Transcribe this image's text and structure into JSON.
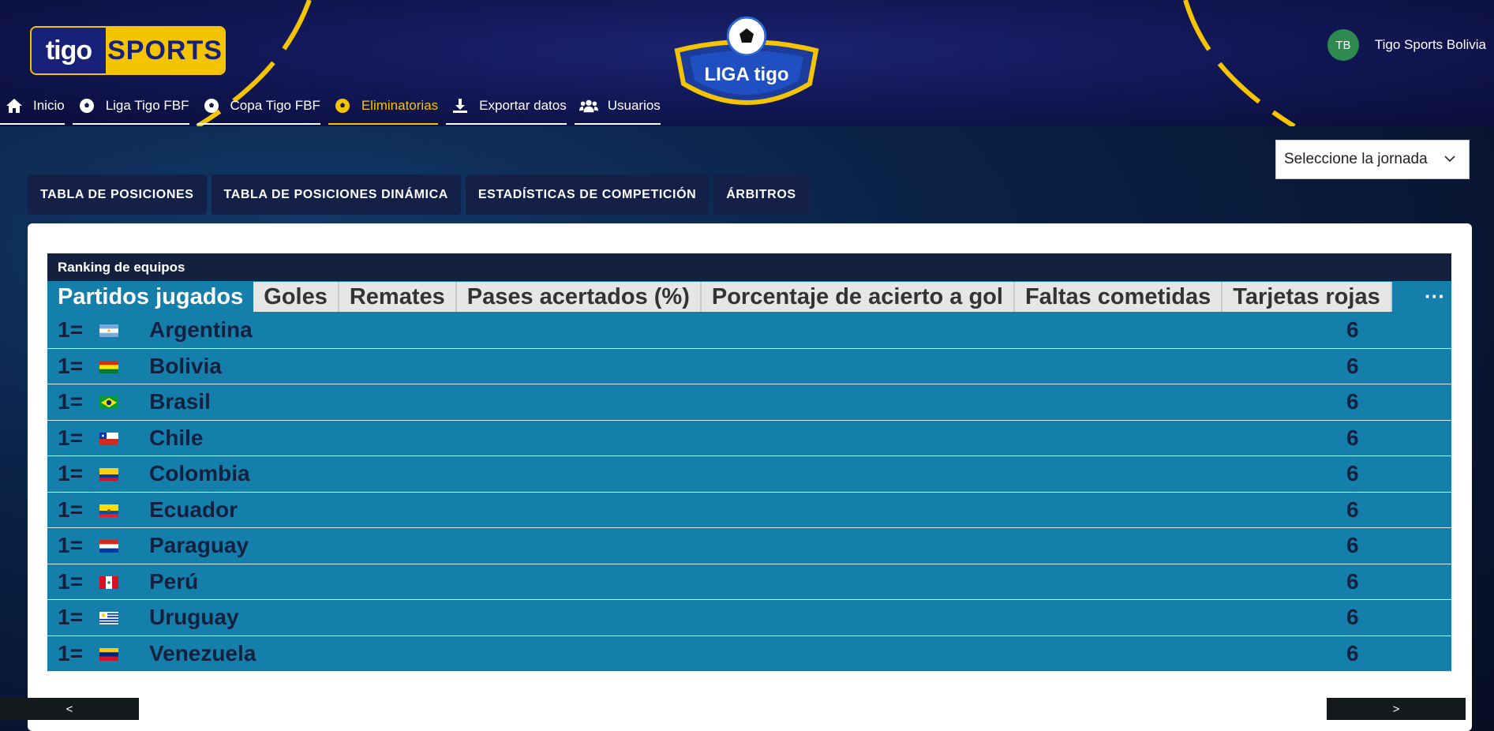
{
  "brand": {
    "tigo": "tigo",
    "sports": "SPORTS",
    "liga_logo_text": "LIGA tigo"
  },
  "nav": [
    {
      "label": "Inicio",
      "icon": "home-icon"
    },
    {
      "label": "Liga Tigo FBF",
      "icon": "soccer-ball-icon"
    },
    {
      "label": "Copa Tigo FBF",
      "icon": "soccer-ball-icon"
    },
    {
      "label": "Eliminatorias",
      "icon": "soccer-ball-icon",
      "active": true
    },
    {
      "label": "Exportar datos",
      "icon": "download-icon"
    },
    {
      "label": "Usuarios",
      "icon": "users-icon"
    }
  ],
  "user": {
    "initials": "TB",
    "name": "Tigo Sports Bolivia"
  },
  "jornada": {
    "label": "Seleccione la jornada"
  },
  "tabs": [
    "TABLA DE POSICIONES",
    "TABLA DE POSICIONES DINÁMICA",
    "ESTADÍSTICAS DE COMPETICIÓN",
    "ÁRBITROS"
  ],
  "ranking": {
    "title": "Ranking de equipos",
    "columns": [
      "Partidos jugados",
      "Goles",
      "Remates",
      "Pases acertados (%)",
      "Porcentaje de acierto a gol",
      "Faltas cometidas",
      "Tarjetas rojas"
    ],
    "more": "···",
    "rows": [
      {
        "rank": "1=",
        "team": "Argentina",
        "flag": "argentina",
        "value": "6"
      },
      {
        "rank": "1=",
        "team": "Bolivia",
        "flag": "bolivia",
        "value": "6"
      },
      {
        "rank": "1=",
        "team": "Brasil",
        "flag": "brasil",
        "value": "6"
      },
      {
        "rank": "1=",
        "team": "Chile",
        "flag": "chile",
        "value": "6"
      },
      {
        "rank": "1=",
        "team": "Colombia",
        "flag": "colombia",
        "value": "6"
      },
      {
        "rank": "1=",
        "team": "Ecuador",
        "flag": "ecuador",
        "value": "6"
      },
      {
        "rank": "1=",
        "team": "Paraguay",
        "flag": "paraguay",
        "value": "6"
      },
      {
        "rank": "1=",
        "team": "Perú",
        "flag": "peru",
        "value": "6"
      },
      {
        "rank": "1=",
        "team": "Uruguay",
        "flag": "uruguay",
        "value": "6"
      },
      {
        "rank": "1=",
        "team": "Venezuela",
        "flag": "venezuela",
        "value": "6"
      }
    ]
  },
  "pager": {
    "prev": "<",
    "next": ">"
  },
  "colors": {
    "accent": "#f5c400",
    "table": "#137faa",
    "header_dark": "#13213f"
  }
}
